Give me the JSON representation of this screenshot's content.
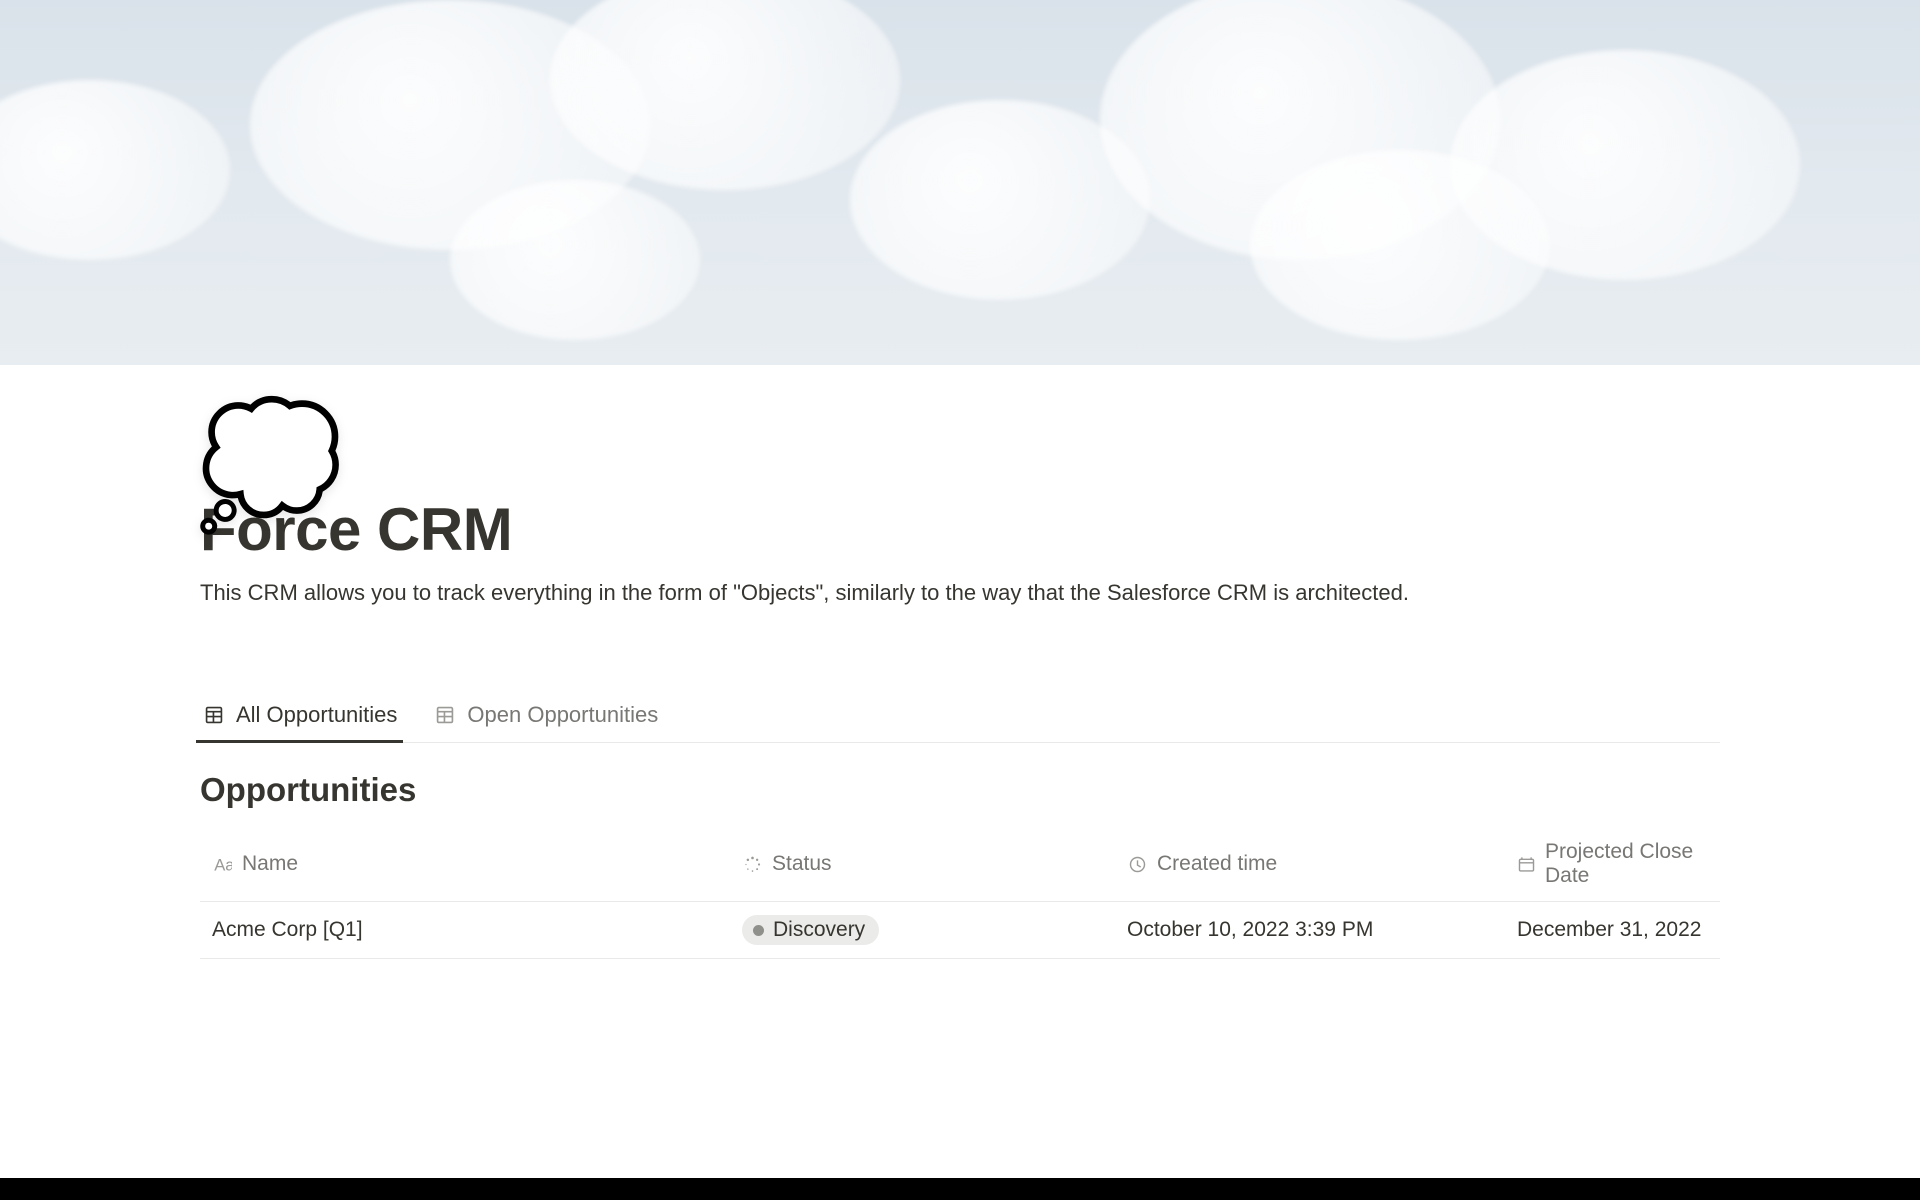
{
  "page": {
    "icon": "💭",
    "title": "Force CRM",
    "description": "This CRM allows you to track everything in the form of \"Objects\", similarly to the way that the Salesforce CRM is architected."
  },
  "tabs": [
    {
      "label": "All Opportunities",
      "active": true
    },
    {
      "label": "Open Opportunities",
      "active": false
    }
  ],
  "database": {
    "title": "Opportunities",
    "columns": {
      "name": "Name",
      "status": "Status",
      "created": "Created time",
      "projected": "Projected Close Date"
    },
    "rows": [
      {
        "name": "Acme Corp [Q1]",
        "status": "Discovery",
        "created": "October 10, 2022 3:39 PM",
        "projected": "December 31, 2022"
      }
    ]
  }
}
